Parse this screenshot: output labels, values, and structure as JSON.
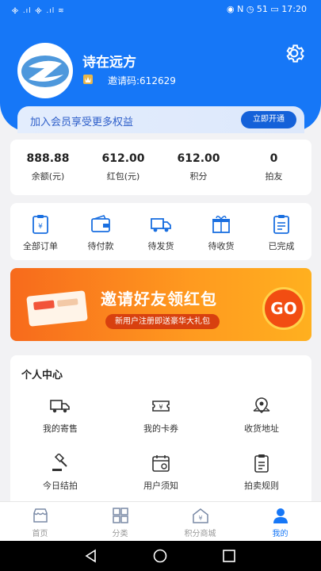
{
  "status_bar": {
    "left_text": "᯽ .ıl ᯽ .ıl ≋",
    "right_text": "◉ N ◷ 51 ▭ 17:20"
  },
  "profile": {
    "username": "诗在远方",
    "invite_label": "邀请码:612629"
  },
  "member_banner": {
    "text": "加入会员享受更多权益",
    "button": "立即开通"
  },
  "stats": [
    {
      "value": "888.88",
      "label": "余额(元)"
    },
    {
      "value": "612.00",
      "label": "红包(元)"
    },
    {
      "value": "612.00",
      "label": "积分"
    },
    {
      "value": "0",
      "label": "拍友"
    }
  ],
  "orders": [
    {
      "label": "全部订单",
      "icon": "all-orders-icon"
    },
    {
      "label": "待付款",
      "icon": "wallet-icon"
    },
    {
      "label": "待发货",
      "icon": "truck-icon"
    },
    {
      "label": "待收货",
      "icon": "gift-box-icon"
    },
    {
      "label": "已完成",
      "icon": "completed-list-icon"
    }
  ],
  "promo": {
    "title": "邀请好友领红包",
    "subtitle": "新用户注册即送豪华大礼包",
    "go": "GO"
  },
  "personal_center": {
    "title": "个人中心",
    "items": [
      {
        "label": "我的寄售",
        "icon": "truck-icon"
      },
      {
        "label": "我的卡券",
        "icon": "coupon-icon"
      },
      {
        "label": "收货地址",
        "icon": "map-pin-icon"
      },
      {
        "label": "今日结拍",
        "icon": "gavel-icon"
      },
      {
        "label": "用户须知",
        "icon": "calendar-icon"
      },
      {
        "label": "拍卖规则",
        "icon": "clipboard-icon"
      }
    ]
  },
  "bottom_nav": [
    {
      "label": "首页",
      "icon": "store-icon"
    },
    {
      "label": "分类",
      "icon": "grid-icon"
    },
    {
      "label": "积分商城",
      "icon": "points-house-icon"
    },
    {
      "label": "我的",
      "icon": "person-icon",
      "active": true
    }
  ],
  "colors": {
    "primary": "#1677f7",
    "promo_orange": "#f76a1c",
    "page_bg": "#f2f2f4"
  }
}
